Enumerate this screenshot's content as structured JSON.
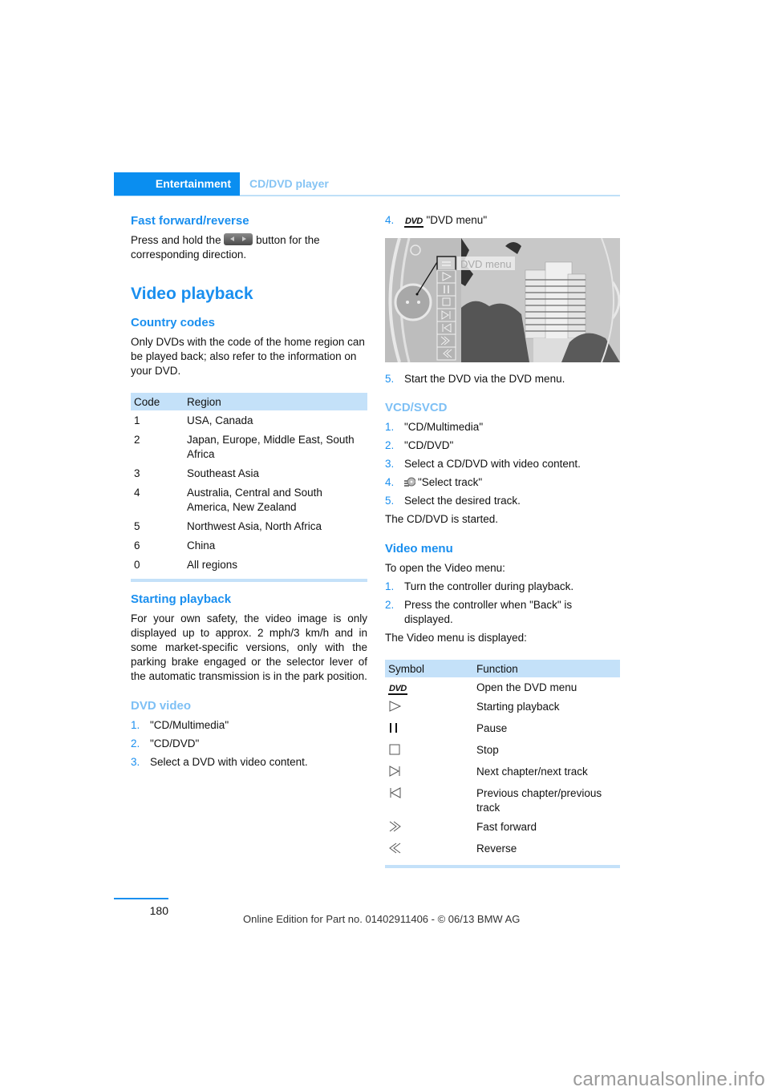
{
  "header": {
    "section": "Entertainment",
    "subsection": "CD/DVD player"
  },
  "left": {
    "fast_forward": {
      "title": "Fast forward/reverse",
      "text_before": "Press and hold the",
      "text_after": "button for the corresponding direction.",
      "button_icon": "seek-buttons-icon"
    },
    "video_playback_title": "Video playback",
    "country_codes": {
      "title": "Country codes",
      "text": "Only DVDs with the code of the home region can be played back; also refer to the information on your DVD.",
      "table": {
        "headers": [
          "Code",
          "Region"
        ],
        "rows": [
          [
            "1",
            "USA, Canada"
          ],
          [
            "2",
            "Japan, Europe, Middle East, South Africa"
          ],
          [
            "3",
            "Southeast Asia"
          ],
          [
            "4",
            "Australia, Central and South America, New Zealand"
          ],
          [
            "5",
            "Northwest Asia, North Africa"
          ],
          [
            "6",
            "China"
          ],
          [
            "0",
            "All regions"
          ]
        ]
      }
    },
    "starting_playback": {
      "title": "Starting playback",
      "text": "For your own safety, the video image is only displayed up to approx. 2 mph/3 km/h and in some market-specific versions, only with the parking brake engaged or the selector lever of the automatic transmission is in the park position."
    },
    "dvd_video": {
      "title": "DVD video",
      "steps": [
        {
          "n": "1.",
          "text": "\"CD/Multimedia\""
        },
        {
          "n": "2.",
          "text": "\"CD/DVD\""
        },
        {
          "n": "3.",
          "text": "Select a DVD with video content."
        }
      ]
    }
  },
  "right": {
    "dvd_step4": {
      "n": "4.",
      "icon": "dvd-logo-icon",
      "logo_text": "DVD",
      "text": "\"DVD menu\""
    },
    "screen": {
      "menu_label": "DVD menu"
    },
    "dvd_step5": {
      "n": "5.",
      "text": "Start the DVD via the DVD menu."
    },
    "vcd": {
      "title": "VCD/SVCD",
      "steps": [
        {
          "n": "1.",
          "text": "\"CD/Multimedia\""
        },
        {
          "n": "2.",
          "text": "\"CD/DVD\""
        },
        {
          "n": "3.",
          "text": "Select a CD/DVD with video content."
        },
        {
          "n": "4.",
          "text": "\"Select track\"",
          "icon": "select-track-icon"
        },
        {
          "n": "5.",
          "text": "Select the desired track."
        }
      ],
      "result": "The CD/DVD is started."
    },
    "video_menu": {
      "title": "Video menu",
      "intro": "To open the Video menu:",
      "steps": [
        {
          "n": "1.",
          "text": "Turn the controller during playback."
        },
        {
          "n": "2.",
          "text": "Press the controller when \"Back\" is displayed."
        }
      ],
      "result": "The Video menu is displayed:",
      "table": {
        "headers": [
          "Symbol",
          "Function"
        ],
        "rows": [
          {
            "icon": "dvd-logo-icon",
            "function": "Open the DVD menu"
          },
          {
            "icon": "play-icon",
            "function": "Starting playback"
          },
          {
            "icon": "pause-icon",
            "function": "Pause"
          },
          {
            "icon": "stop-icon",
            "function": "Stop"
          },
          {
            "icon": "next-track-icon",
            "function": "Next chapter/next track"
          },
          {
            "icon": "previous-track-icon",
            "function": "Previous chapter/previous track"
          },
          {
            "icon": "fast-forward-icon",
            "function": "Fast forward"
          },
          {
            "icon": "reverse-icon",
            "function": "Reverse"
          }
        ]
      }
    }
  },
  "footer": {
    "page_number": "180",
    "edition": "Online Edition for Part no. 01402911406 - © 06/13 BMW AG",
    "watermark": "carmanualsonline.info"
  },
  "colors": {
    "accent": "#1a8fef",
    "header_tab": "#0a8ef0",
    "light_accent": "#7ec0f5",
    "table_header": "#c4e1f9"
  }
}
